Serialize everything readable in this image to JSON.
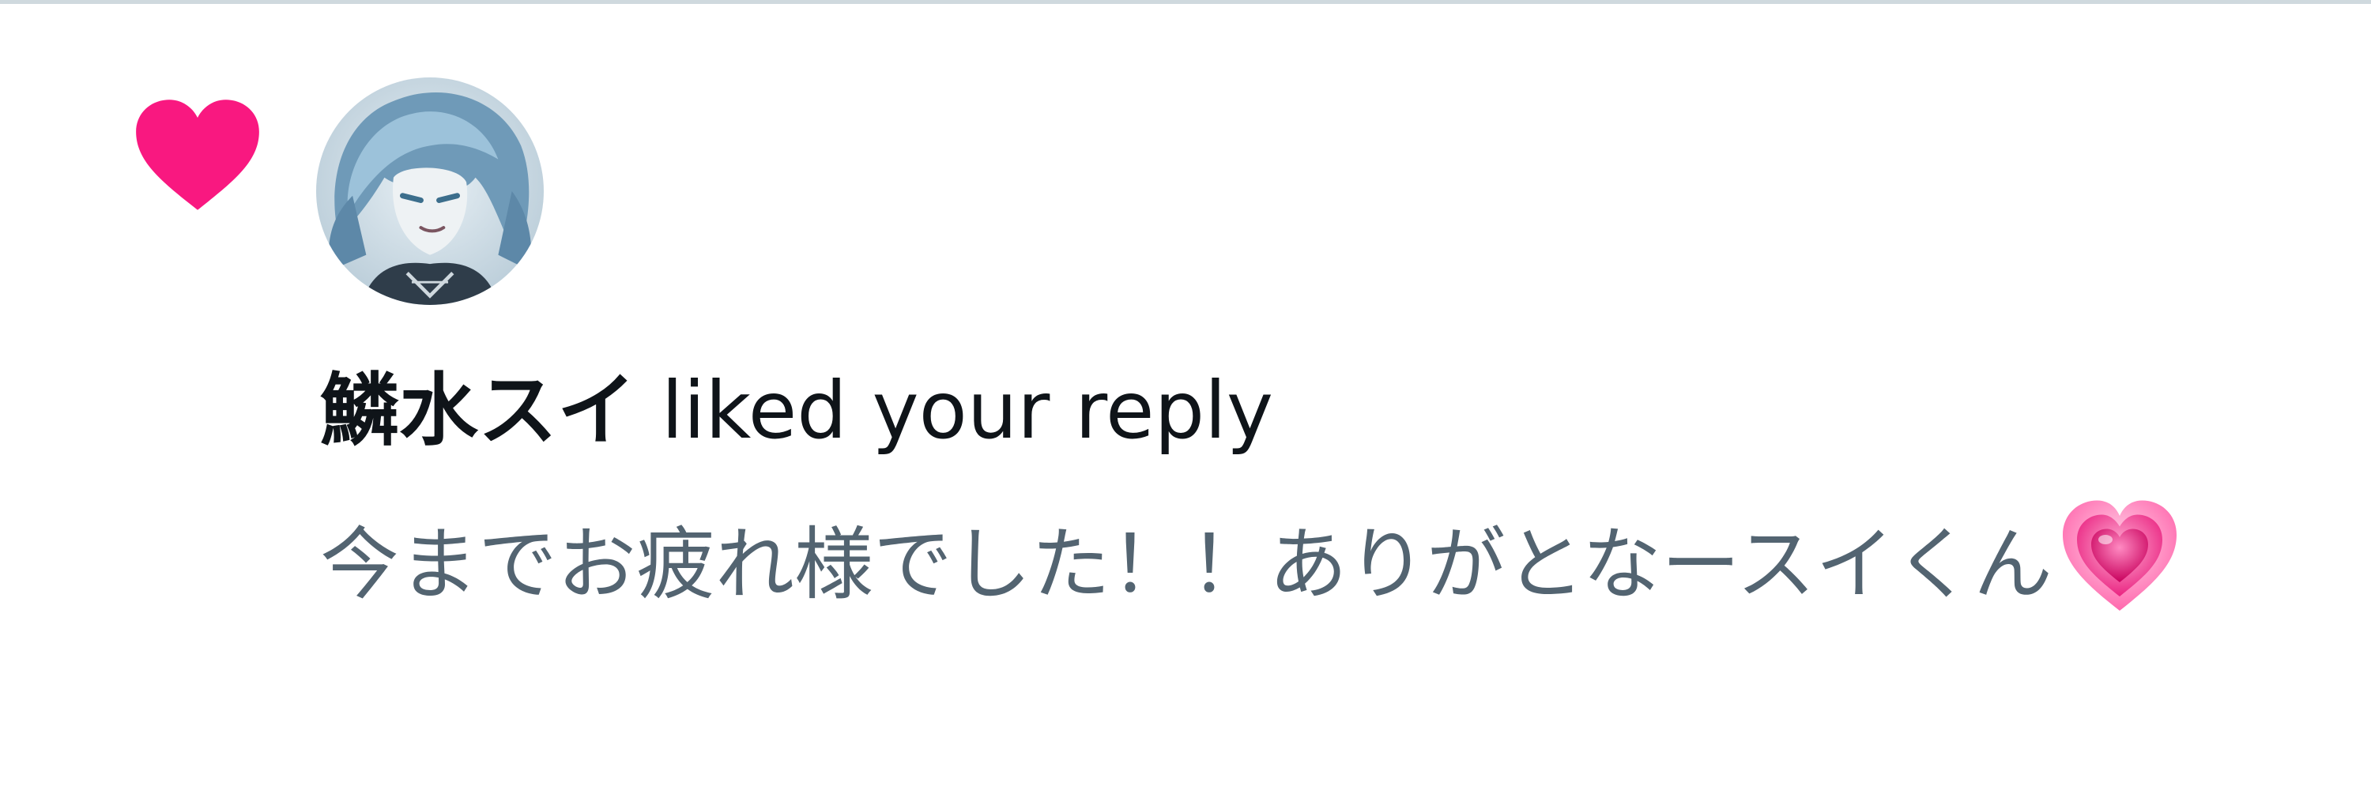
{
  "notification": {
    "type_icon": "heart-icon",
    "like_color": "#f91880",
    "avatar_icon": "avatar-portrait",
    "actor_name": "鱗水スイ",
    "action_text": "liked your reply",
    "reply_text": "今までお疲れ様でした！！ありがとなースイくん",
    "reply_emoji": "growing-heart-emoji"
  }
}
